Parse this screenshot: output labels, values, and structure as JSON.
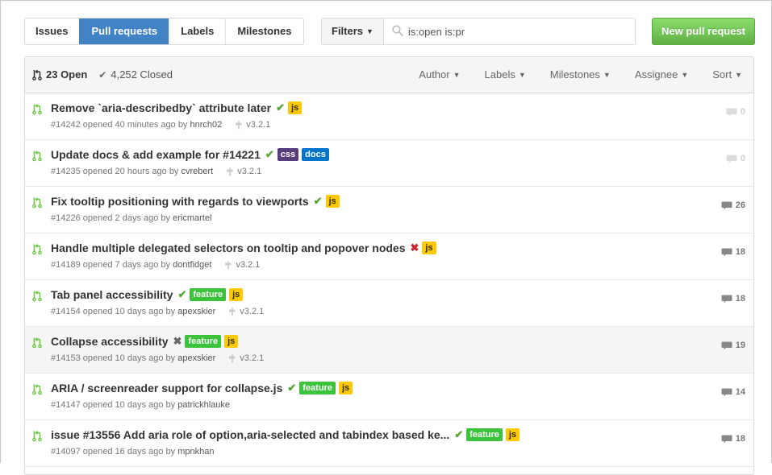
{
  "subnav": {
    "tabs": [
      {
        "label": "Issues",
        "selected": false
      },
      {
        "label": "Pull requests",
        "selected": true
      },
      {
        "label": "Labels",
        "selected": false
      },
      {
        "label": "Milestones",
        "selected": false
      }
    ],
    "filters_label": "Filters",
    "search_value": "is:open is:pr",
    "new_button": "New pull request"
  },
  "header": {
    "open_count": "23 Open",
    "closed_count": "4,252 Closed",
    "menus": [
      "Author",
      "Labels",
      "Milestones",
      "Assignee",
      "Sort"
    ]
  },
  "colors": {
    "accent": "#4183c4",
    "success": "#55a532",
    "failure": "#cb2431",
    "label_js": "#fbca04",
    "label_css": "#563d7c",
    "label_docs": "#0075ca",
    "label_feature": "#3bc43b"
  },
  "pull_requests": [
    {
      "title": "Remove `aria-describedby` attribute later",
      "status": "ok",
      "labels": [
        {
          "name": "js",
          "color": "#fbca04",
          "text": "#332900"
        }
      ],
      "number": "#14242",
      "opened": "opened 40 minutes ago by",
      "author": "hnrch02",
      "milestone": "v3.2.1",
      "comments": "0"
    },
    {
      "title": "Update docs & add example for #14221",
      "status": "ok",
      "labels": [
        {
          "name": "css",
          "color": "#563d7c",
          "text": "#ffffff"
        },
        {
          "name": "docs",
          "color": "#0075ca",
          "text": "#ffffff"
        }
      ],
      "number": "#14235",
      "opened": "opened 20 hours ago by",
      "author": "cvrebert",
      "milestone": "v3.2.1",
      "comments": "0"
    },
    {
      "title": "Fix tooltip positioning with regards to viewports",
      "status": "ok",
      "labels": [
        {
          "name": "js",
          "color": "#fbca04",
          "text": "#332900"
        }
      ],
      "number": "#14226",
      "opened": "opened 2 days ago by",
      "author": "ericmartel",
      "milestone": "",
      "comments": "26"
    },
    {
      "title": "Handle multiple delegated selectors on tooltip and popover nodes",
      "status": "fail",
      "labels": [
        {
          "name": "js",
          "color": "#fbca04",
          "text": "#332900"
        }
      ],
      "number": "#14189",
      "opened": "opened 7 days ago by",
      "author": "dontfidget",
      "milestone": "v3.2.1",
      "comments": "18"
    },
    {
      "title": "Tab panel accessibility",
      "status": "ok",
      "labels": [
        {
          "name": "feature",
          "color": "#3bc43b",
          "text": "#ffffff"
        },
        {
          "name": "js",
          "color": "#fbca04",
          "text": "#332900"
        }
      ],
      "number": "#14154",
      "opened": "opened 10 days ago by",
      "author": "apexskier",
      "milestone": "v3.2.1",
      "comments": "18"
    },
    {
      "title": "Collapse accessibility",
      "status": "neutral",
      "labels": [
        {
          "name": "feature",
          "color": "#3bc43b",
          "text": "#ffffff"
        },
        {
          "name": "js",
          "color": "#fbca04",
          "text": "#332900"
        }
      ],
      "number": "#14153",
      "opened": "opened 10 days ago by",
      "author": "apexskier",
      "milestone": "v3.2.1",
      "comments": "19",
      "highlight": true
    },
    {
      "title": "ARIA / screenreader support for collapse.js",
      "status": "ok",
      "labels": [
        {
          "name": "feature",
          "color": "#3bc43b",
          "text": "#ffffff"
        },
        {
          "name": "js",
          "color": "#fbca04",
          "text": "#332900"
        }
      ],
      "number": "#14147",
      "opened": "opened 10 days ago by",
      "author": "patrickhlauke",
      "milestone": "",
      "comments": "14"
    },
    {
      "title": "issue #13556 Add aria role of option,aria-selected and tabindex based ke...",
      "status": "ok",
      "labels": [
        {
          "name": "feature",
          "color": "#3bc43b",
          "text": "#ffffff"
        },
        {
          "name": "js",
          "color": "#fbca04",
          "text": "#332900"
        }
      ],
      "number": "#14097",
      "opened": "opened 16 days ago by",
      "author": "mpnkhan",
      "milestone": "",
      "comments": "18"
    }
  ]
}
